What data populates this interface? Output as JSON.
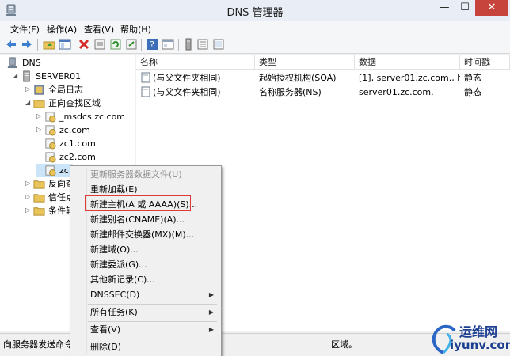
{
  "window": {
    "title": "DNS 管理器",
    "min": "—",
    "max": "☐",
    "close": "✕"
  },
  "menubar": [
    {
      "label": "文件(F)"
    },
    {
      "label": "操作(A)"
    },
    {
      "label": "查看(V)"
    },
    {
      "label": "帮助(H)"
    }
  ],
  "toolbar_icons": [
    "back-arrow-icon",
    "forward-arrow-icon",
    "up-folder-icon",
    "show-hide-tree-icon",
    "delete-icon",
    "properties-icon",
    "refresh-icon",
    "export-icon",
    "help-icon",
    "console-icon",
    "server-icon",
    "list-icon",
    "zone-icon"
  ],
  "tree": {
    "items": [
      {
        "label": "DNS",
        "icon": "dns-icon"
      },
      {
        "label": "SERVER01",
        "icon": "server-icon"
      },
      {
        "label": "全局日志",
        "icon": "log-icon"
      },
      {
        "label": "正向查找区域",
        "icon": "folder-icon"
      },
      {
        "label": "_msdcs.zc.com",
        "icon": "zone-icon"
      },
      {
        "label": "zc.com",
        "icon": "zone-icon"
      },
      {
        "label": "zc1.com",
        "icon": "zone-icon"
      },
      {
        "label": "zc2.com",
        "icon": "zone-icon"
      },
      {
        "label": "zc",
        "icon": "zone-icon"
      },
      {
        "label": "反向查",
        "icon": "folder-icon"
      },
      {
        "label": "信任点",
        "icon": "folder-icon"
      },
      {
        "label": "条件转",
        "icon": "folder-icon"
      }
    ]
  },
  "list": {
    "columns": [
      "名称",
      "类型",
      "数据",
      "时间戳"
    ],
    "rows": [
      {
        "name": "(与父文件夹相同)",
        "type": "起始授权机构(SOA)",
        "data": "[1], server01.zc.com., h...",
        "timestamp": "静态"
      },
      {
        "name": "(与父文件夹相同)",
        "type": "名称服务器(NS)",
        "data": "server01.zc.com.",
        "timestamp": "静态"
      }
    ]
  },
  "status": {
    "text": "向服务器发送命令",
    "tail": "区域。"
  },
  "context_menu": {
    "items": [
      {
        "label": "更新服务器数据文件(U)",
        "disabled": true
      },
      {
        "label": "重新加载(E)"
      },
      {
        "label": "新建主机(A 或 AAAA)(S)...",
        "highlighted": true
      },
      {
        "label": "新建别名(CNAME)(A)..."
      },
      {
        "label": "新建邮件交换器(MX)(M)..."
      },
      {
        "label": "新建域(O)..."
      },
      {
        "label": "新建委派(G)..."
      },
      {
        "label": "其他新记录(C)..."
      },
      {
        "label": "DNSSEC(D)",
        "submenu": true
      },
      {
        "label": "所有任务(K)",
        "submenu": true
      },
      {
        "label": "查看(V)",
        "submenu": true
      },
      {
        "label": "删除(D)"
      }
    ]
  },
  "watermark": {
    "top": "运维网",
    "bottom": "iyunv.com"
  },
  "colors": {
    "close": "#c7443c",
    "highlight_box": "#e03a36",
    "folder": "#e8c45a",
    "watermark": "#1c3f91"
  }
}
